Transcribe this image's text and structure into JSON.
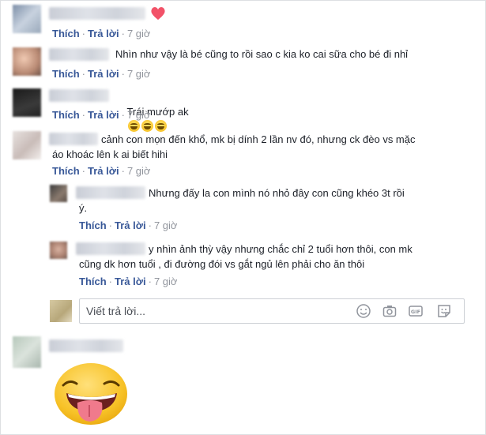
{
  "actions": {
    "like": "Thích",
    "reply": "Trả lời",
    "sep": "·"
  },
  "comments": [
    {
      "text": "",
      "time": "7 giờ"
    },
    {
      "text": "Nhìn như vậy là bé cũng to rồi sao c kia ko cai sữa cho bé đi nhỉ",
      "time": "7 giờ"
    },
    {
      "text": "Trái mướp ak",
      "time": "7 giờ"
    },
    {
      "text": "cảnh con mọn đến khổ, mk bị dính 2 lần nv đó, nhưng ck đèo vs mặc\náo khoác lên k ai biết hihi",
      "time": "7 giờ"
    }
  ],
  "replies": [
    {
      "text": "Nhưng đấy la con mình nó nhỏ đây con cũng khéo 3t rồi\ný.",
      "time": "7 giờ"
    },
    {
      "text": "y nhìn ảnh thỳ vậy nhưng chắc chỉ 2 tuổi hơn thôi, con mk\ncũng dk hơn tuổi , đi đường đói vs gắt ngủ lên phải cho ăn thôi",
      "time": "7 giờ"
    }
  ],
  "reply_box": {
    "placeholder": "Viết trả lời..."
  },
  "icons": [
    "heart-icon",
    "laughing-emoji-icon",
    "smiley-icon",
    "camera-icon",
    "gif-icon",
    "sticker-icon",
    "tongue-out-emoji-icon"
  ],
  "colors": {
    "link": "#385898",
    "meta": "#90949c",
    "text": "#1d2129",
    "heart": "#f25268"
  }
}
